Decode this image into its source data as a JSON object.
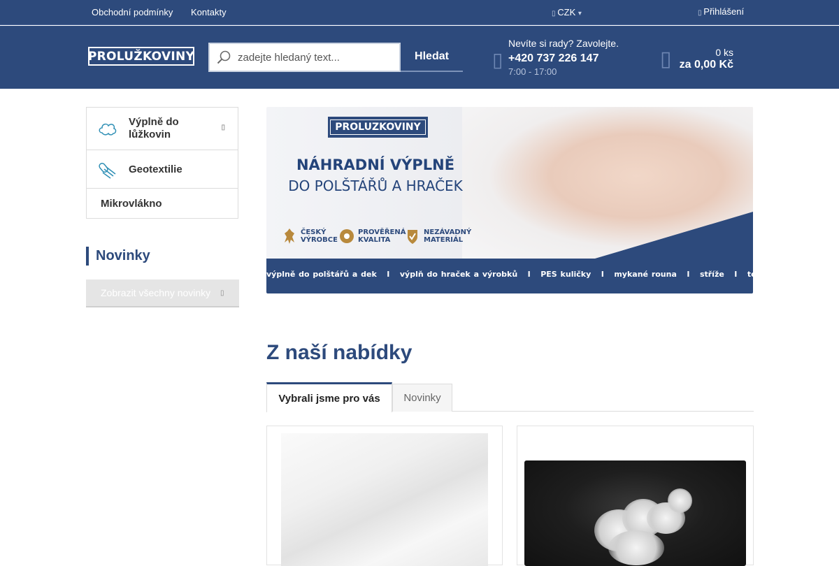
{
  "topbar": {
    "links": [
      "Obchodní podmínky",
      "Kontakty"
    ],
    "currency": "CZK",
    "currency_glyph": "▾",
    "login": "Přihlášení"
  },
  "header": {
    "logo_text": "PROLUŽKOVINY",
    "search": {
      "placeholder": "zadejte hledaný text...",
      "button": "Hledat"
    },
    "help": {
      "text": "Nevíte si rady? Zavolejte.",
      "phone": "+420 737 226 147",
      "hours": "7:00 - 17:00"
    },
    "cart": {
      "count": "0 ks",
      "total": "za 0,00 Kč"
    }
  },
  "sidebar": {
    "categories": [
      {
        "label": "Výplně do lůžkovin",
        "icon": "cloud-icon",
        "has_submenu": true
      },
      {
        "label": "Geotextilie",
        "icon": "textile-roll-icon",
        "has_submenu": false
      },
      {
        "label": "Mikrovlákno",
        "icon": "",
        "has_submenu": false
      }
    ],
    "news_title": "Novinky",
    "show_all_button": "Zobrazit všechny novinky"
  },
  "banner": {
    "logo_text": "PROLUZKOVINY",
    "title": "NÁHRADNÍ VÝPLNĚ",
    "subtitle": "DO POLŠTÁŘŮ A HRAČEK",
    "badges": [
      {
        "line1": "ČESKÝ",
        "line2": "VÝROBCE"
      },
      {
        "line1": "PROVĚŘENÁ",
        "line2": "KVALITA"
      },
      {
        "line1": "NEZÁVADNÝ",
        "line2": "MATERIÁL"
      }
    ],
    "categories_line": "výplně do polštářů a dek   I   výplň do hraček a výrobků   I   PES kuličky   I   mykané rouna   I   stříže   I   termorouna"
  },
  "offer": {
    "title": "Z naší nabídky",
    "tabs": [
      {
        "label": "Vybrali jsme pro vás",
        "active": true
      },
      {
        "label": "Novinky",
        "active": false
      }
    ]
  },
  "colors": {
    "brand": "#2d4a7c",
    "topbar": "#2d4a7c"
  }
}
